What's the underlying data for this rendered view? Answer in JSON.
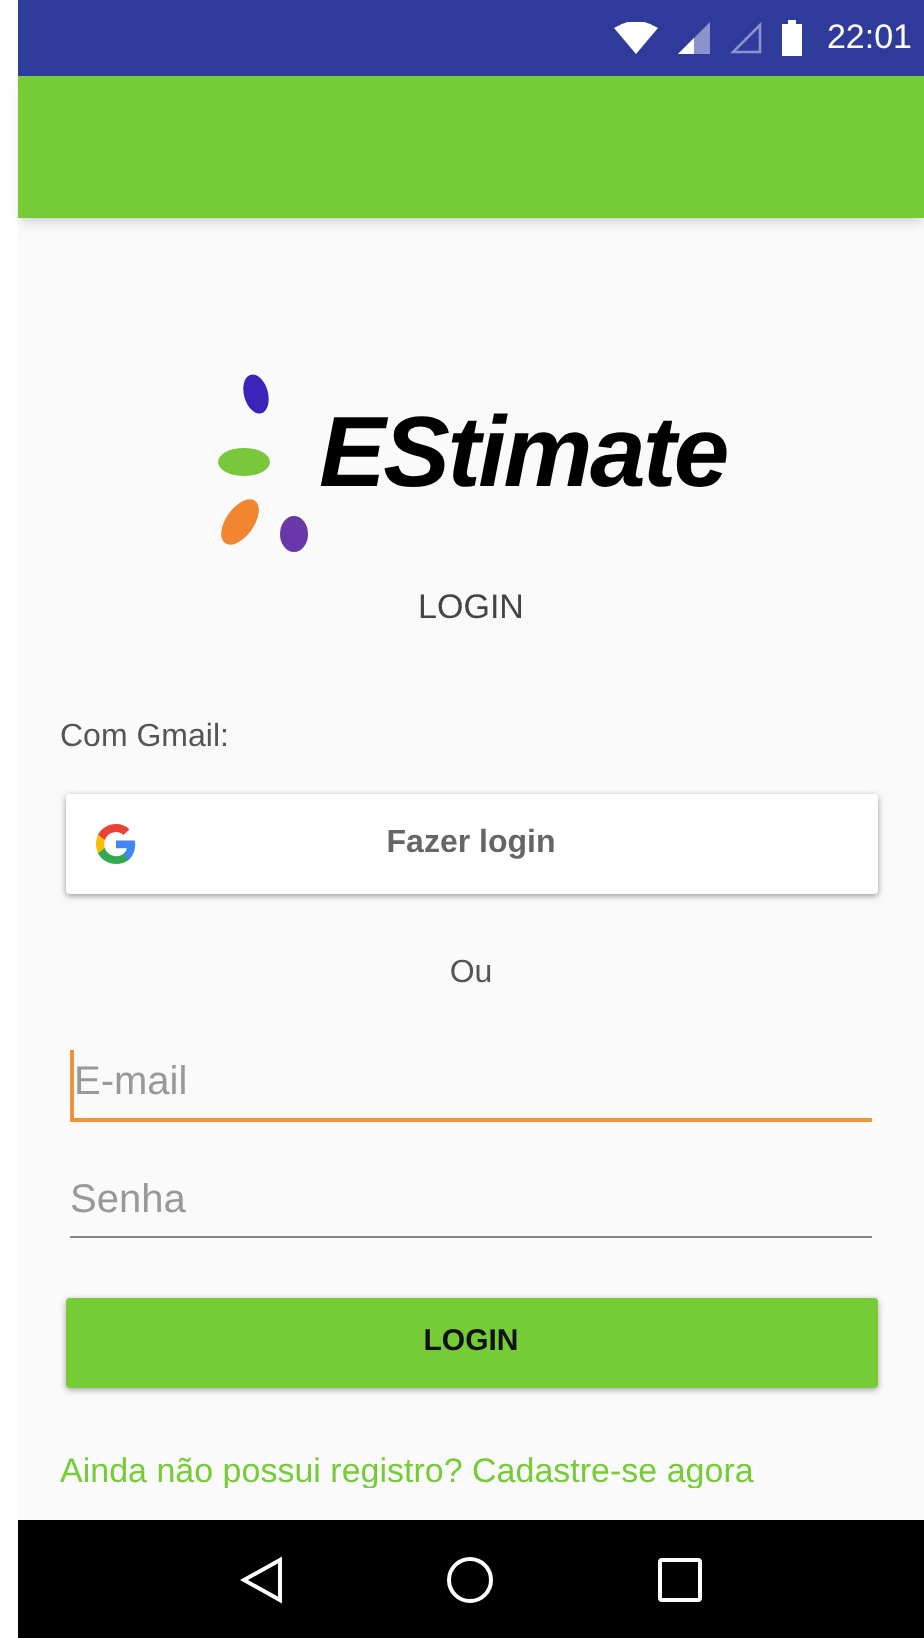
{
  "status_bar": {
    "time": "22:01"
  },
  "logo": {
    "text": "EStimate"
  },
  "title": "LOGIN",
  "gmail_label": "Com Gmail:",
  "google_button": {
    "label": "Fazer login"
  },
  "separator": "Ou",
  "fields": [
    {
      "placeholder": "E-mail",
      "focused": true
    },
    {
      "placeholder": "Senha",
      "focused": false
    }
  ],
  "login_button": {
    "label": "LOGIN"
  },
  "register_link": "Ainda não possui registro? Cadastre-se agora"
}
